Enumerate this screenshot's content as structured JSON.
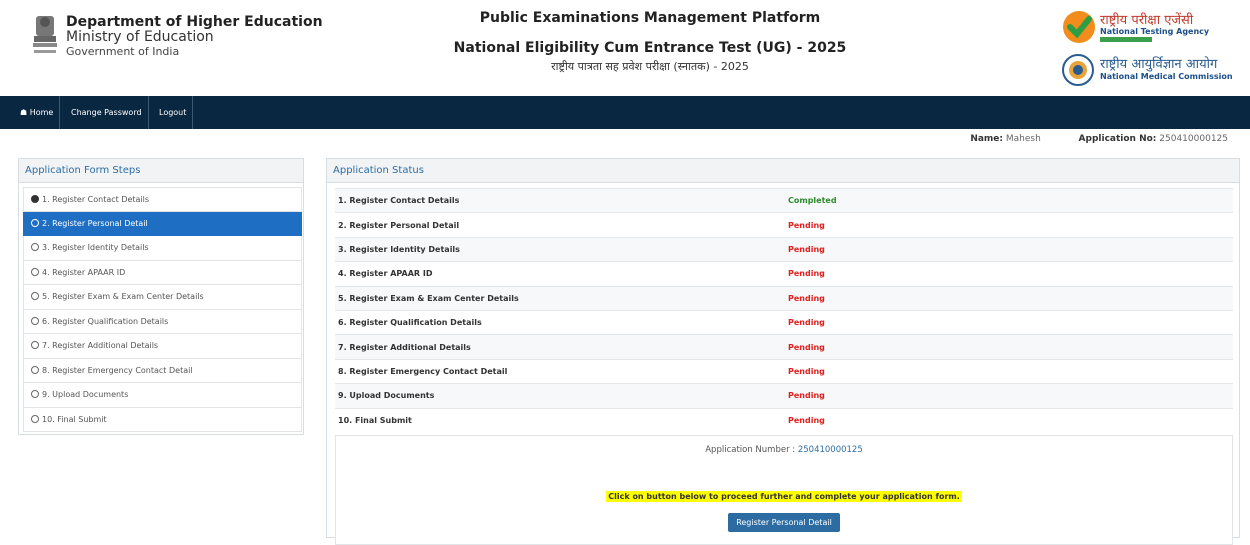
{
  "header": {
    "dept_line1": "Department of Higher Education",
    "dept_line2": "Ministry of Education",
    "dept_line3": "Government of India",
    "title": "Public Examinations Management Platform",
    "exam_title": "National Eligibility Cum Entrance Test (UG) - 2025",
    "exam_title_hindi": "राष्ट्रीय पात्रता सह प्रवेश परीक्षा (स्नातक) - 2025",
    "nta_hindi": "राष्ट्रीय परीक्षा एजेंसी",
    "nta_english": "National Testing Agency",
    "nmc_hindi": "राष्ट्रीय आयुर्विज्ञान आयोग",
    "nmc_english": "National Medical Commission"
  },
  "nav": {
    "home": "Home",
    "change_password": "Change Password",
    "logout": "Logout"
  },
  "user": {
    "name_label": "Name:",
    "name": "Mahesh",
    "app_label": "Application No:",
    "app_no": "250410000125"
  },
  "steps_panel": {
    "title": "Application Form Steps",
    "steps": [
      {
        "label": "1. Register Contact Details",
        "done": true,
        "active": false
      },
      {
        "label": "2. Register Personal Detail",
        "done": false,
        "active": true
      },
      {
        "label": "3. Register Identity Details",
        "done": false,
        "active": false
      },
      {
        "label": "4. Register APAAR ID",
        "done": false,
        "active": false
      },
      {
        "label": "5. Register Exam & Exam Center Details",
        "done": false,
        "active": false
      },
      {
        "label": "6. Register Qualification Details",
        "done": false,
        "active": false
      },
      {
        "label": "7. Register Additional Details",
        "done": false,
        "active": false
      },
      {
        "label": "8. Register Emergency Contact Detail",
        "done": false,
        "active": false
      },
      {
        "label": "9. Upload Documents",
        "done": false,
        "active": false
      },
      {
        "label": "10. Final Submit",
        "done": false,
        "active": false
      }
    ]
  },
  "status_panel": {
    "title": "Application Status",
    "rows": [
      {
        "step": "1. Register Contact Details",
        "status": "Completed"
      },
      {
        "step": "2. Register Personal Detail",
        "status": "Pending"
      },
      {
        "step": "3. Register Identity Details",
        "status": "Pending"
      },
      {
        "step": "4. Register APAAR ID",
        "status": "Pending"
      },
      {
        "step": "5. Register Exam & Exam Center Details",
        "status": "Pending"
      },
      {
        "step": "6. Register Qualification Details",
        "status": "Pending"
      },
      {
        "step": "7. Register Additional Details",
        "status": "Pending"
      },
      {
        "step": "8. Register Emergency Contact Detail",
        "status": "Pending"
      },
      {
        "step": "9. Upload Documents",
        "status": "Pending"
      },
      {
        "step": "10. Final Submit",
        "status": "Pending"
      }
    ],
    "app_number_label": "Application Number :",
    "app_number": "250410000125",
    "proceed_text": "Click on button below to proceed further and complete your application form.",
    "button_label": "Register Personal Detail"
  },
  "colors": {
    "navbar": "#0a2742",
    "accent": "#1e6fc4",
    "completed": "#2e8b2e",
    "pending": "#e02020",
    "highlight": "#ffff00"
  },
  "icons": {
    "home": "home-icon",
    "step_done": "check-circle-icon",
    "step_todo": "circle-icon"
  }
}
